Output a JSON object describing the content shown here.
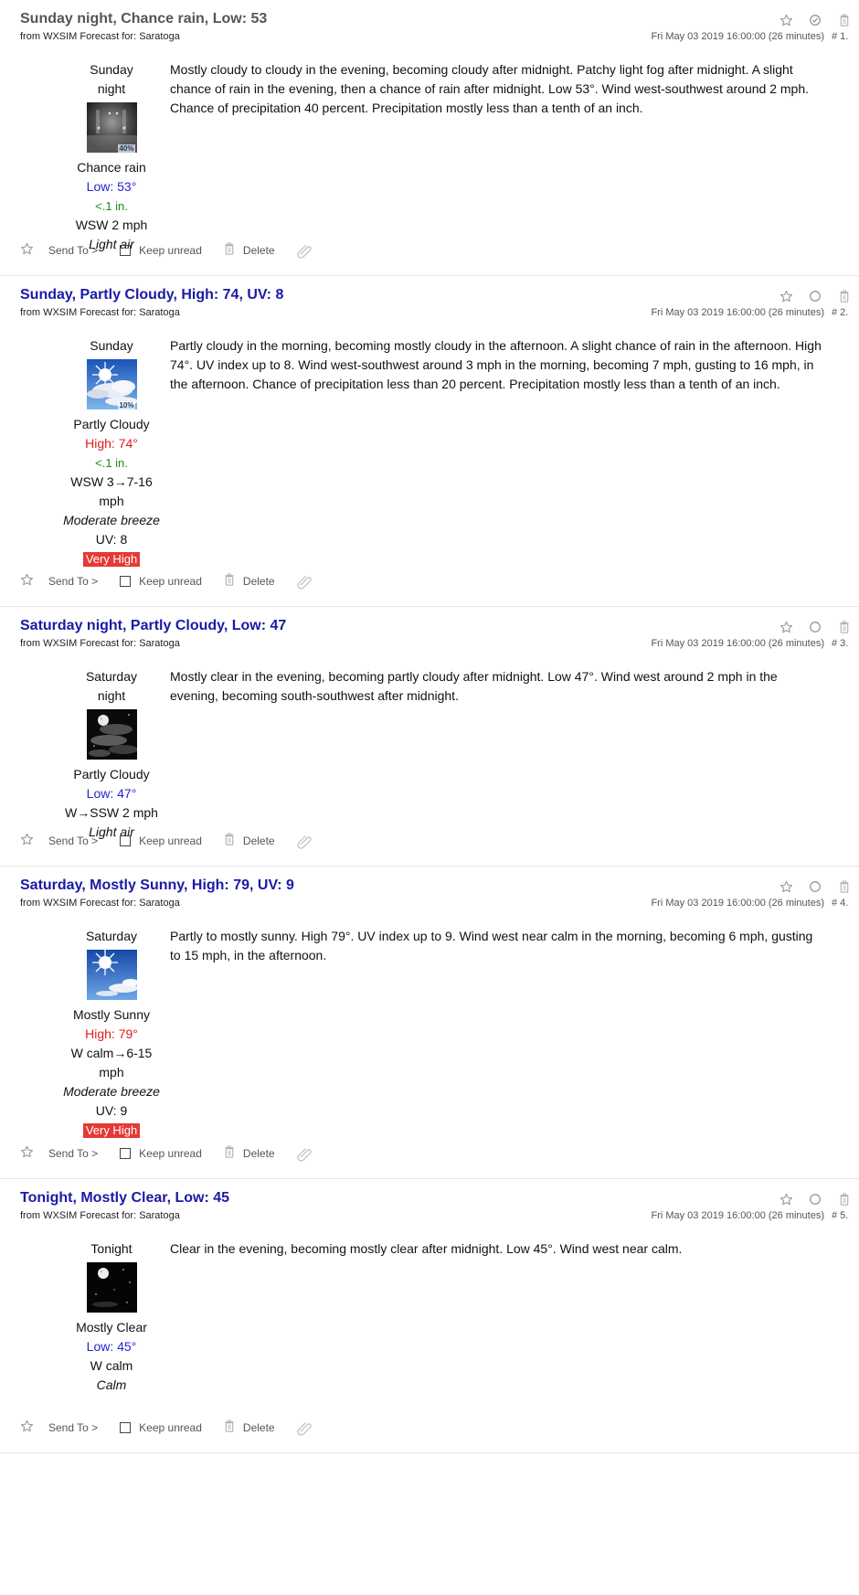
{
  "common": {
    "from_label": "from",
    "from_source": "WXSIM Forecast for: Saratoga",
    "date": "Fri May 03 2019 16:00:00 (26 minutes)",
    "footer": {
      "send_to": "Send To >",
      "keep_unread": "Keep unread",
      "delete": "Delete"
    }
  },
  "messages": [
    {
      "subject": "Sunday night, Chance rain, Low: 53",
      "number": "# 1.",
      "read": true,
      "period": [
        "Sunday",
        "night"
      ],
      "icon": "night-fog-rain-icon",
      "icon_pct": "40%",
      "condition": "Chance rain",
      "temp": "Low: 53°",
      "temp_type": "low",
      "precip": "<.1 in.",
      "wind": [
        "WSW 2 mph"
      ],
      "wind_desc": "Light air",
      "uv": "",
      "uv_level": "",
      "detail": "Mostly cloudy to cloudy in the evening, becoming cloudy after midnight. Patchy light fog after midnight. A slight chance of rain in the evening, then a chance of rain after midnight. Low 53°. Wind west-southwest around 2 mph. Chance of precipitation 40 percent. Precipitation mostly less than a tenth of an inch."
    },
    {
      "subject": "Sunday, Partly Cloudy, High: 74, UV: 8",
      "number": "# 2.",
      "read": false,
      "period": [
        "Sunday"
      ],
      "icon": "partly-cloudy-day-icon",
      "icon_pct": "10%",
      "condition": "Partly Cloudy",
      "temp": "High: 74°",
      "temp_type": "high",
      "precip": "<.1 in.",
      "wind": [
        "WSW 3→7-16",
        "mph"
      ],
      "wind_desc": "Moderate breeze",
      "uv": "UV: 8",
      "uv_level": "Very High",
      "detail": "Partly cloudy in the morning, becoming mostly cloudy in the afternoon. A slight chance of rain in the afternoon. High 74°. UV index up to 8. Wind west-southwest around 3 mph in the morning, becoming 7 mph, gusting to 16 mph, in the afternoon. Chance of precipitation less than 20 percent. Precipitation mostly less than a tenth of an inch."
    },
    {
      "subject": "Saturday night, Partly Cloudy, Low: 47",
      "number": "# 3.",
      "read": false,
      "period": [
        "Saturday",
        "night"
      ],
      "icon": "partly-cloudy-night-icon",
      "icon_pct": "",
      "condition": "Partly Cloudy",
      "temp": "Low: 47°",
      "temp_type": "low",
      "precip": "",
      "wind": [
        "W→SSW 2 mph"
      ],
      "wind_desc": "Light air",
      "uv": "",
      "uv_level": "",
      "detail": "Mostly clear in the evening, becoming partly cloudy after midnight. Low 47°. Wind west around 2 mph in the evening, becoming south-southwest after midnight."
    },
    {
      "subject": "Saturday, Mostly Sunny, High: 79, UV: 9",
      "number": "# 4.",
      "read": false,
      "period": [
        "Saturday"
      ],
      "icon": "mostly-sunny-icon",
      "icon_pct": "",
      "condition": "Mostly Sunny",
      "temp": "High: 79°",
      "temp_type": "high",
      "precip": "",
      "wind": [
        "W calm→6-15",
        "mph"
      ],
      "wind_desc": "Moderate breeze",
      "uv": "UV: 9",
      "uv_level": "Very High",
      "detail": "Partly to mostly sunny. High 79°. UV index up to 9. Wind west near calm in the morning, becoming 6 mph, gusting to 15 mph, in the afternoon."
    },
    {
      "subject": "Tonight, Mostly Clear, Low: 45",
      "number": "# 5.",
      "read": false,
      "period": [
        "Tonight"
      ],
      "icon": "mostly-clear-night-icon",
      "icon_pct": "",
      "condition": "Mostly Clear",
      "temp": "Low: 45°",
      "temp_type": "low",
      "precip": "",
      "wind": [
        "W calm"
      ],
      "wind_desc": "Calm",
      "uv": "",
      "uv_level": "",
      "detail": "Clear in the evening, becoming mostly clear after midnight. Low 45°. Wind west near calm."
    }
  ]
}
